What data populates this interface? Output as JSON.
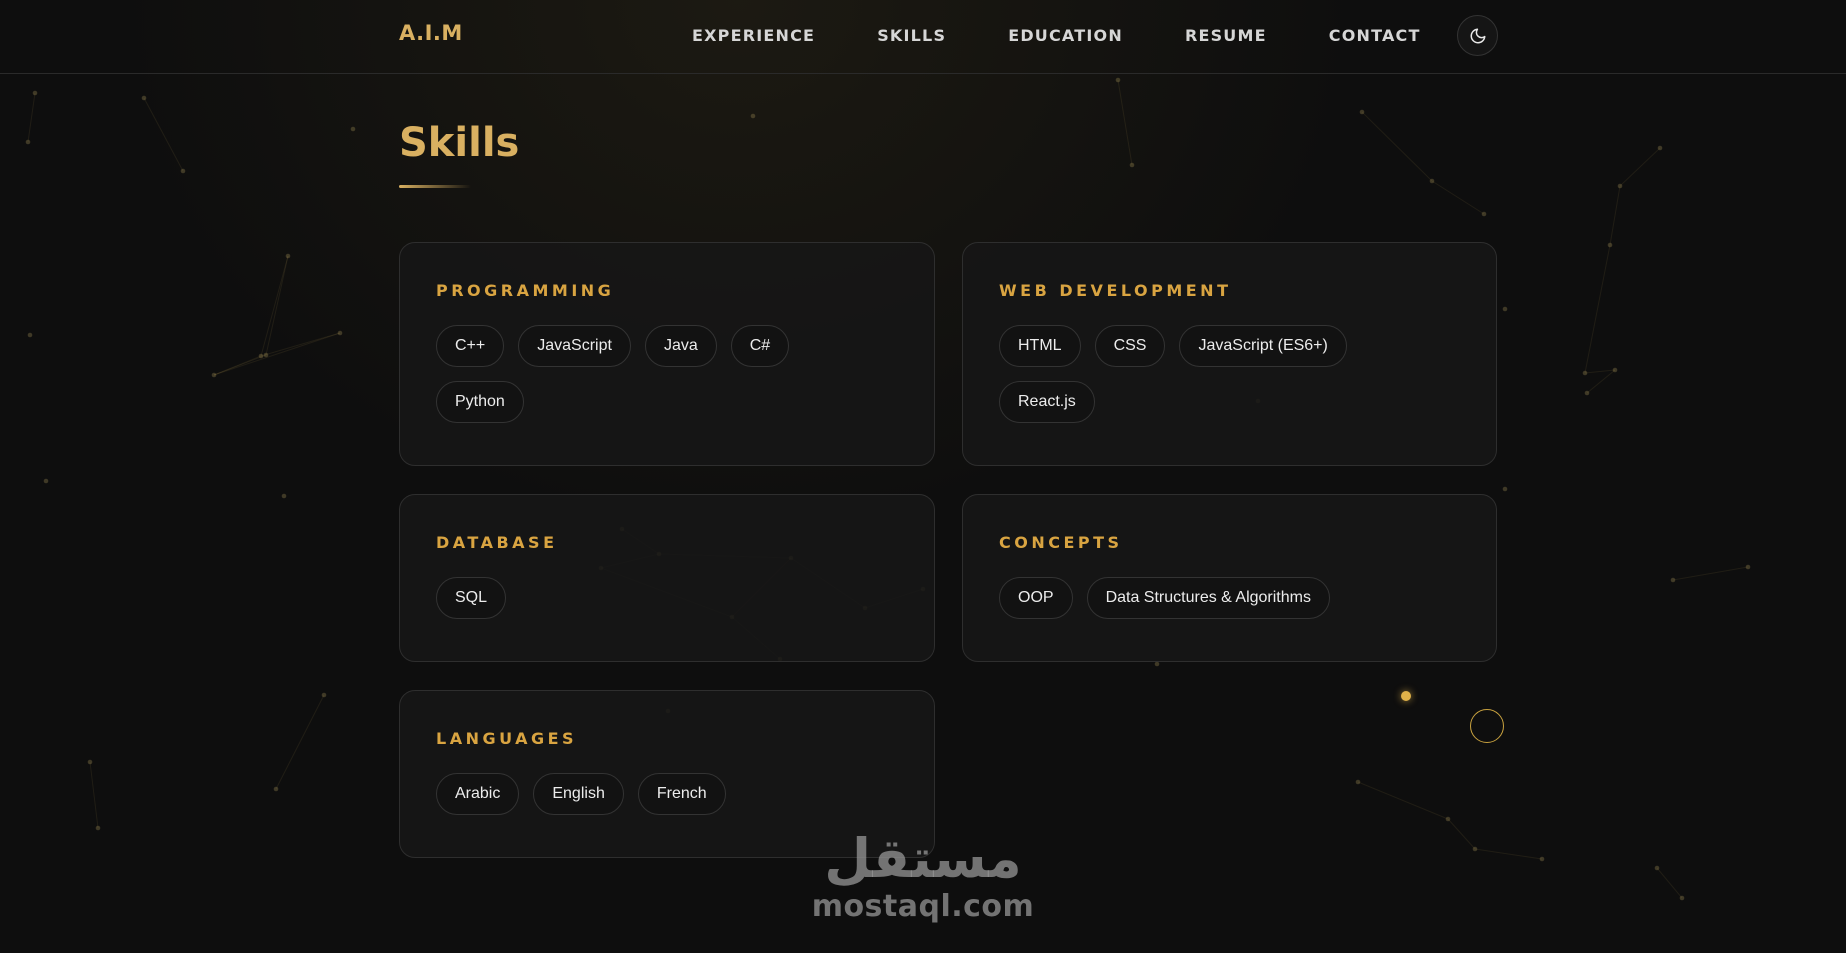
{
  "header": {
    "logo": "A.I.M",
    "nav": [
      "EXPERIENCE",
      "SKILLS",
      "EDUCATION",
      "RESUME",
      "CONTACT"
    ],
    "theme_toggle_icon": "moon-icon"
  },
  "page_title": "Skills",
  "colors": {
    "accent": "#d9b061",
    "category_title": "#d9a441",
    "background": "#0e0e0e",
    "card": "#161616"
  },
  "cards": [
    {
      "title": "PROGRAMMING",
      "tags": [
        "C++",
        "JavaScript",
        "Java",
        "C#",
        "Python"
      ]
    },
    {
      "title": "WEB DEVELOPMENT",
      "tags": [
        "HTML",
        "CSS",
        "JavaScript (ES6+)",
        "React.js"
      ]
    },
    {
      "title": "DATABASE",
      "tags": [
        "SQL"
      ]
    },
    {
      "title": "CONCEPTS",
      "tags": [
        "OOP",
        "Data Structures & Algorithms"
      ]
    },
    {
      "title": "LANGUAGES",
      "tags": [
        "Arabic",
        "English",
        "French"
      ]
    }
  ],
  "watermark": {
    "arabic": "مستقل",
    "latin": "mostaql.com"
  }
}
